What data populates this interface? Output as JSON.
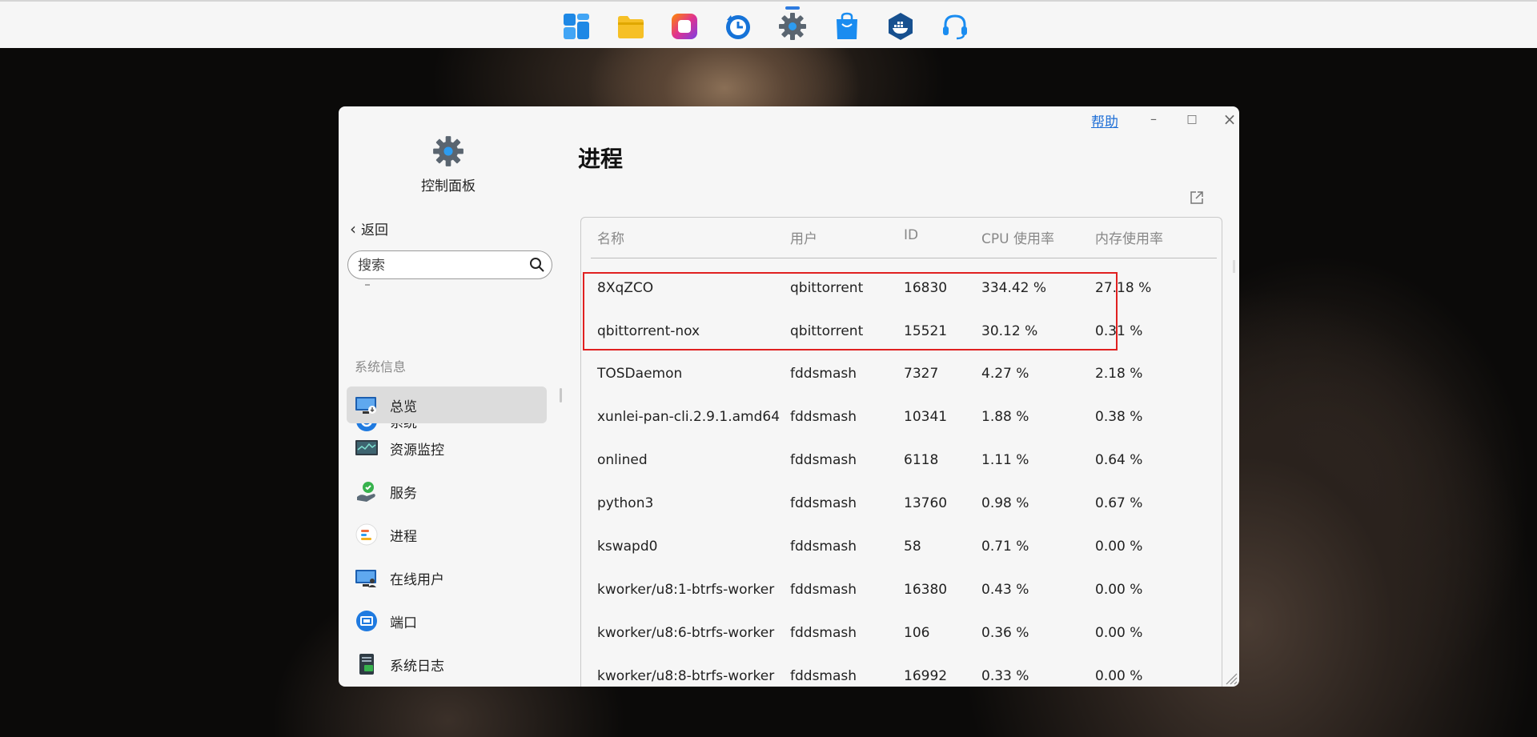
{
  "taskbar": {
    "apps": [
      {
        "icon": "file-manager-tiles-icon",
        "color": "#1e88e5"
      },
      {
        "icon": "folder-icon",
        "color": "#f6c026"
      },
      {
        "icon": "photos-icon",
        "color": "#e0338f"
      },
      {
        "icon": "backup-clock-icon",
        "color": "#1673d8"
      },
      {
        "icon": "settings-gear-icon",
        "color": "#555f69",
        "active": true
      },
      {
        "icon": "app-store-bag-icon",
        "color": "#1a8cf0"
      },
      {
        "icon": "docker-icon",
        "color": "#17508f"
      },
      {
        "icon": "support-headset-icon",
        "color": "#1a8cf0"
      }
    ]
  },
  "window": {
    "help_label": "帮助",
    "minimize_label": "–",
    "maximize_label": "□",
    "close_label": "×"
  },
  "sidebar": {
    "app_title": "控制面板",
    "back_label": "返回",
    "search_placeholder": "搜索",
    "top_item": {
      "label": "系统",
      "icon": "system-refresh-icon"
    },
    "section_label": "系统信息",
    "items": [
      {
        "label": "总览",
        "icon": "monitor-overview-icon",
        "active": true
      },
      {
        "label": "资源监控",
        "icon": "resource-monitor-icon"
      },
      {
        "label": "服务",
        "icon": "services-check-icon"
      },
      {
        "label": "进程",
        "icon": "process-list-icon"
      },
      {
        "label": "在线用户",
        "icon": "online-users-icon"
      },
      {
        "label": "端口",
        "icon": "port-icon"
      },
      {
        "label": "系统日志",
        "icon": "system-log-icon"
      }
    ]
  },
  "main": {
    "page_title": "进程",
    "table": {
      "columns": [
        "名称",
        "用户",
        "ID",
        "CPU 使用率",
        "内存使用率"
      ],
      "rows": [
        {
          "name": "8XqZCO",
          "user": "qbittorrent",
          "id": "16830",
          "cpu": "334.42 %",
          "mem": "27.18 %"
        },
        {
          "name": "qbittorrent-nox",
          "user": "qbittorrent",
          "id": "15521",
          "cpu": "30.12 %",
          "mem": "0.31 %"
        },
        {
          "name": "TOSDaemon",
          "user": "fddsmash",
          "id": "7327",
          "cpu": "4.27 %",
          "mem": "2.18 %"
        },
        {
          "name": "xunlei-pan-cli.2.9.1.amd64",
          "user": "fddsmash",
          "id": "10341",
          "cpu": "1.88 %",
          "mem": "0.38 %"
        },
        {
          "name": "onlined",
          "user": "fddsmash",
          "id": "6118",
          "cpu": "1.11 %",
          "mem": "0.64 %"
        },
        {
          "name": "python3",
          "user": "fddsmash",
          "id": "13760",
          "cpu": "0.98 %",
          "mem": "0.67 %"
        },
        {
          "name": "kswapd0",
          "user": "fddsmash",
          "id": "58",
          "cpu": "0.71 %",
          "mem": "0.00 %"
        },
        {
          "name": "kworker/u8:1-btrfs-worker",
          "user": "fddsmash",
          "id": "16380",
          "cpu": "0.43 %",
          "mem": "0.00 %"
        },
        {
          "name": "kworker/u8:6-btrfs-worker",
          "user": "fddsmash",
          "id": "106",
          "cpu": "0.36 %",
          "mem": "0.00 %"
        },
        {
          "name": "kworker/u8:8-btrfs-worker",
          "user": "fddsmash",
          "id": "16992",
          "cpu": "0.33 %",
          "mem": "0.00 %"
        }
      ]
    }
  },
  "colors": {
    "accent": "#1f6fd6",
    "highlight_border": "#e02020"
  }
}
